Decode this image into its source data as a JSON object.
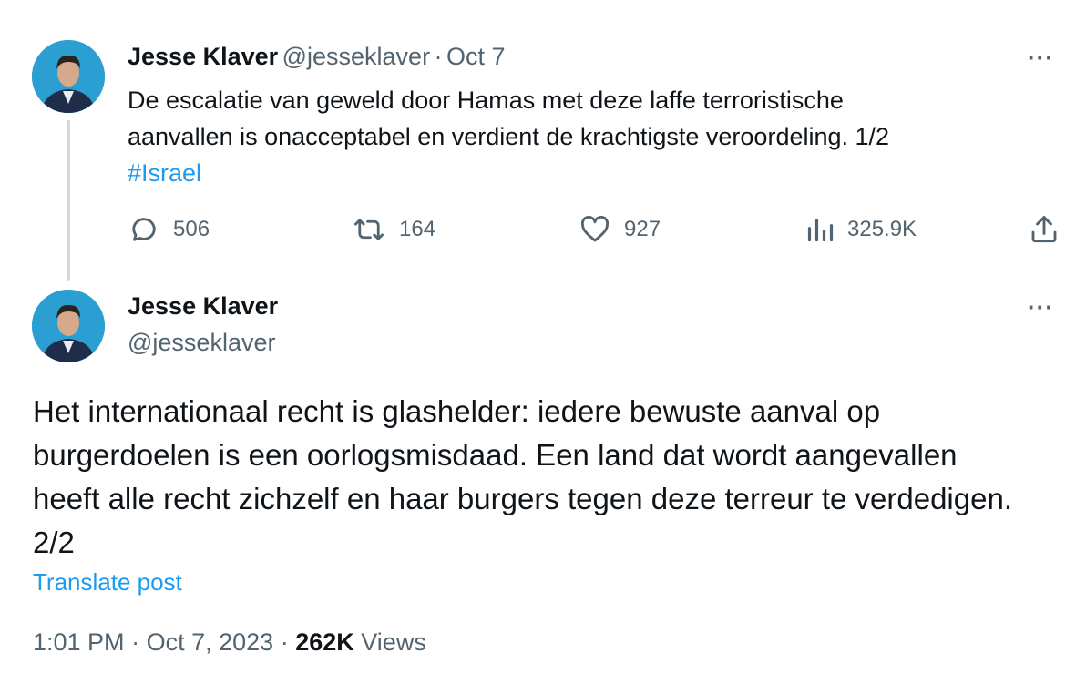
{
  "tweet1": {
    "display_name": "Jesse Klaver",
    "handle": "@jesseklaver",
    "separator": "·",
    "date": "Oct 7",
    "text_line1": "De escalatie van geweld door Hamas met deze laffe terroristische",
    "text_line2": "aanvallen is onacceptabel en verdient de krachtigste veroordeling. 1/2",
    "hashtag": "#Israel",
    "replies": "506",
    "reposts": "164",
    "likes": "927",
    "views": "325.9K",
    "more": "···"
  },
  "tweet2": {
    "display_name": "Jesse Klaver",
    "handle": "@jesseklaver",
    "more": "···",
    "text_line1": "Het internationaal recht is glashelder: iedere bewuste aanval op",
    "text_line2": "burgerdoelen is een oorlogsmisdaad. Een land dat wordt aangevallen",
    "text_line3": "heeft alle recht zichzelf en haar burgers tegen deze terreur te verdedigen.",
    "text_line4": "2/2",
    "translate": "Translate post",
    "time": "1:01 PM",
    "dot": "·",
    "date": "Oct 7, 2023",
    "views_count": "262K",
    "views_label": "Views"
  },
  "colors": {
    "link": "#1d9bf0",
    "muted": "#536471",
    "text": "#0f1419",
    "thread_line": "#cfd9de",
    "avatar_bg": "#2b9fd1"
  },
  "icons": [
    "reply-icon",
    "repost-icon",
    "like-icon",
    "views-icon",
    "share-icon",
    "more-icon"
  ]
}
